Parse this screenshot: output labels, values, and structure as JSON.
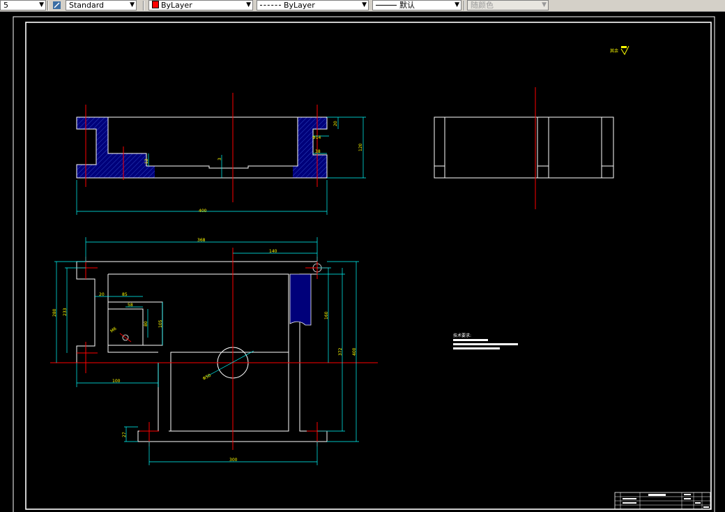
{
  "toolbar": {
    "layer_value": "5",
    "text_style": "Standard",
    "color_value": "ByLayer",
    "linetype_value": "ByLayer",
    "lineweight_value": "默认",
    "plotstyle_value": "随颜色"
  },
  "drawing": {
    "surface_note": "其余",
    "tech_req_title": "技术要求:",
    "front_view": {
      "dim_overall_width": "400",
      "dim_height": "120",
      "dim_top": "20",
      "dim_slot_14": "Φ14",
      "dim_slot_depth": "38",
      "dim_12": "12",
      "dim_3": "3"
    },
    "top_view": {
      "dim_368": "368",
      "dim_140": "140",
      "dim_280": "280",
      "dim_233": "233",
      "dim_20": "20",
      "dim_85": "85",
      "dim_58": "58",
      "dim_80": "80",
      "dim_105": "105",
      "dim_m6": "M6",
      "dim_160": "160",
      "dim_372": "372",
      "dim_400": "400",
      "dim_100": "100",
      "dim_27": "27",
      "dim_300": "300",
      "dim_phi50": "Φ50"
    }
  },
  "colors": {
    "background": "#000000",
    "geometry": "#ffffff",
    "centerline": "#ff0000",
    "dimension": "#00ffff",
    "dim_text": "#ffff00",
    "hatch": "#0000a0"
  }
}
